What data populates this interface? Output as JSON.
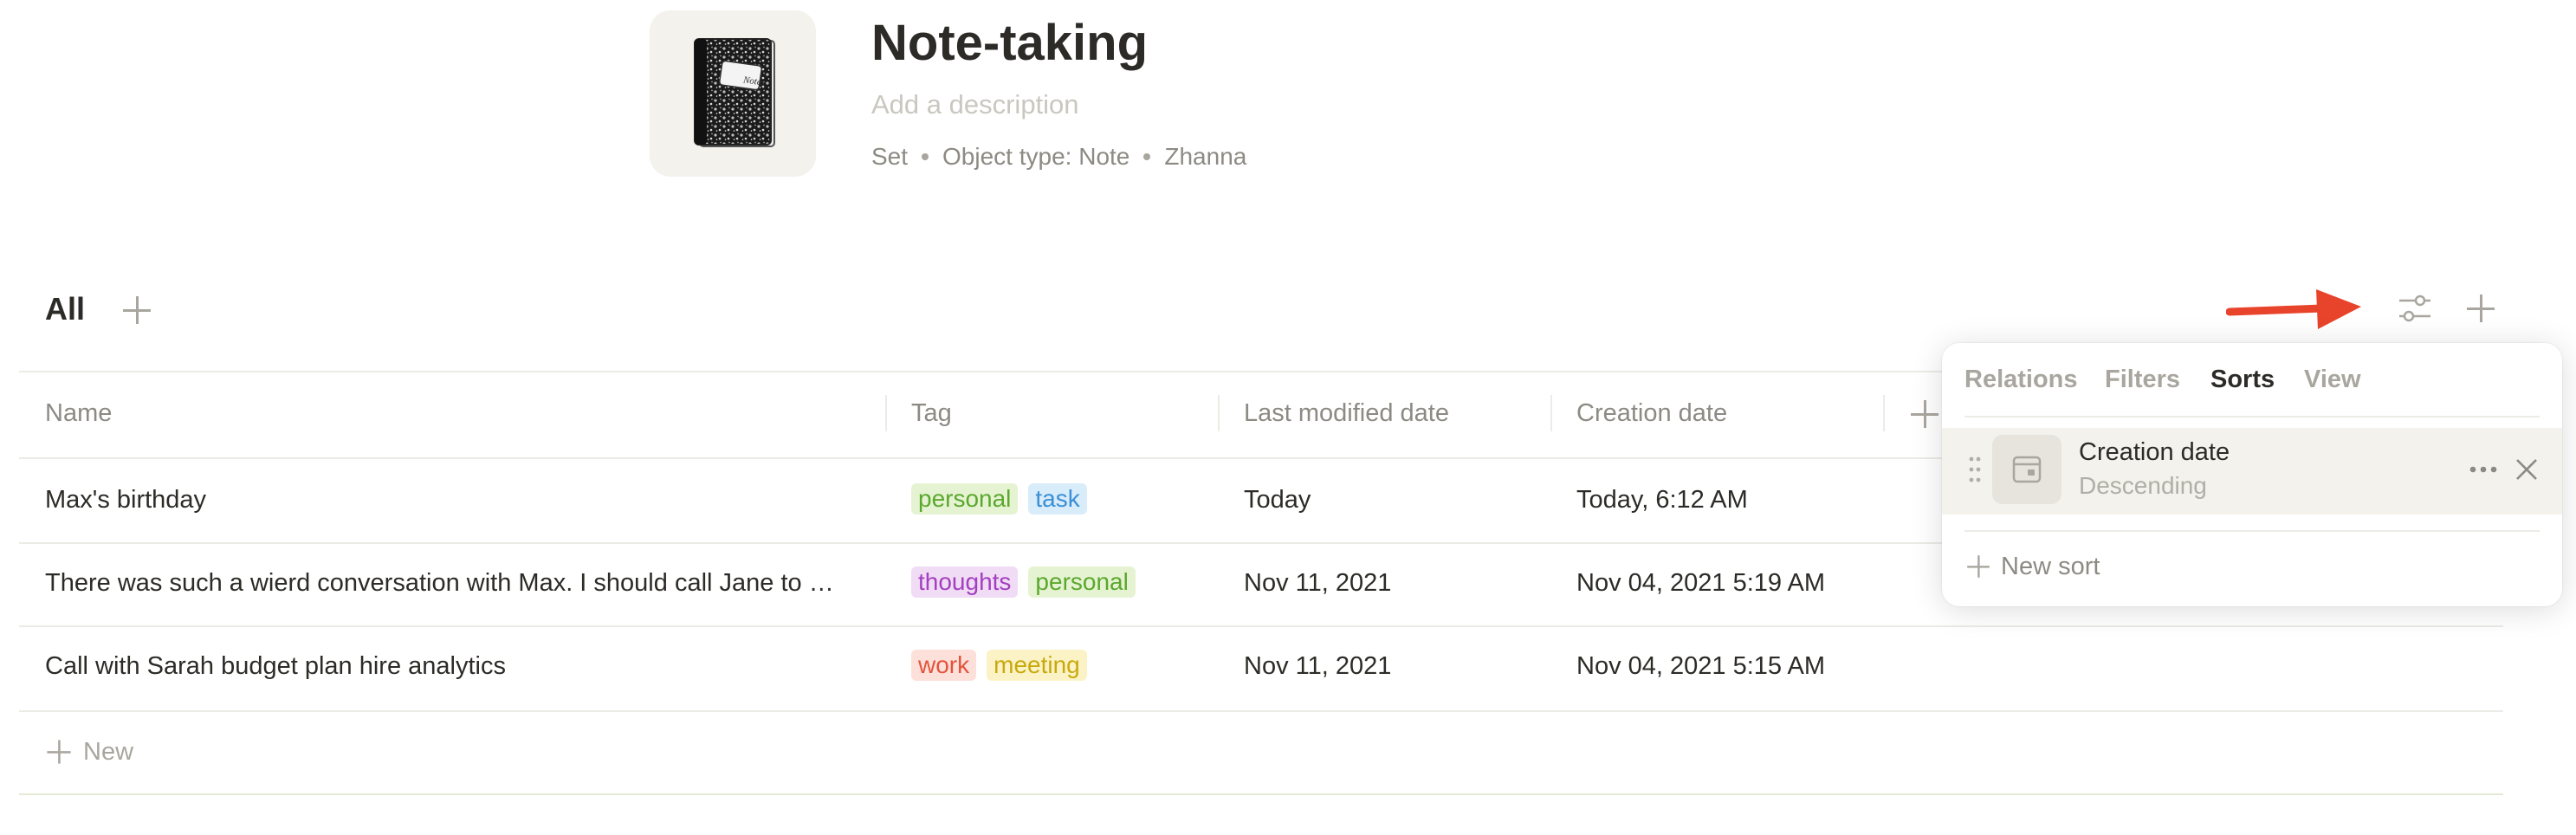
{
  "header": {
    "title": "Note-taking",
    "description_placeholder": "Add a description",
    "meta": [
      "Set",
      "Object type: Note",
      "Zhanna"
    ],
    "icon": "composition-notebook-icon",
    "notebook_label": "Notes"
  },
  "view_bar": {
    "active_view": "All",
    "add_view_icon": "plus-icon",
    "settings_icon": "sliders-icon",
    "add_icon": "plus-icon",
    "annotation": "red-arrow-icon"
  },
  "table": {
    "columns": [
      "Name",
      "Tag",
      "Last modified date",
      "Creation date"
    ],
    "rows": [
      {
        "name": "Max's birthday",
        "tags": [
          {
            "label": "personal",
            "bg": "#e6f3d2",
            "fg": "#5ba82e"
          },
          {
            "label": "task",
            "bg": "#d8ecfa",
            "fg": "#3a8fd6"
          }
        ],
        "modified": "Today",
        "created": "Today, 6:12 AM"
      },
      {
        "name": "There was such a wierd conversation with Max. I should call Jane to …",
        "tags": [
          {
            "label": "thoughts",
            "bg": "#f0dcf5",
            "fg": "#a33fc0"
          },
          {
            "label": "personal",
            "bg": "#e6f3d2",
            "fg": "#5ba82e"
          }
        ],
        "modified": "Nov 11, 2021",
        "created": "Nov 04, 2021 5:19 AM"
      },
      {
        "name": "Call with Sarah budget plan hire analytics",
        "tags": [
          {
            "label": "work",
            "bg": "#fde0da",
            "fg": "#e3543c"
          },
          {
            "label": "meeting",
            "bg": "#fbf3c6",
            "fg": "#c9a90c"
          }
        ],
        "modified": "Nov 11, 2021",
        "created": "Nov 04, 2021 5:15 AM"
      }
    ],
    "new_label": "New"
  },
  "popup": {
    "tabs": [
      "Relations",
      "Filters",
      "Sorts",
      "View"
    ],
    "active_tab": "Sorts",
    "sort": {
      "name": "Creation date",
      "direction": "Descending",
      "icon": "calendar-icon"
    },
    "new_sort_label": "New sort"
  },
  "colors": {
    "accent_arrow": "#e8432b",
    "muted_text": "#8c8a83",
    "divider": "#ecebe6"
  }
}
